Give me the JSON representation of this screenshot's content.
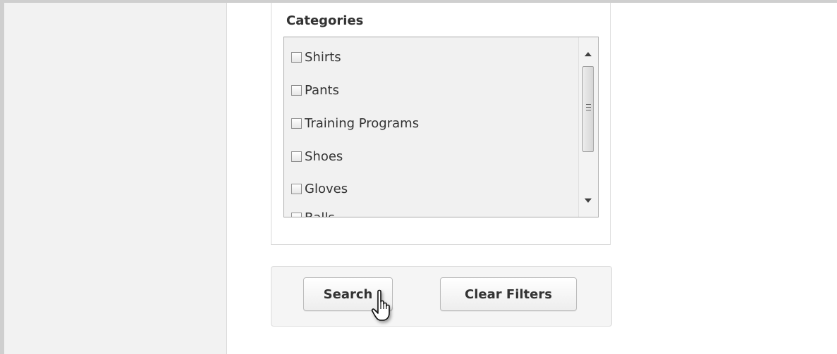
{
  "categories": {
    "title": "Categories",
    "items": [
      {
        "label": "Shirts",
        "checked": false
      },
      {
        "label": "Pants",
        "checked": false
      },
      {
        "label": "Training Programs",
        "checked": false
      },
      {
        "label": "Shoes",
        "checked": false
      },
      {
        "label": "Gloves",
        "checked": false
      },
      {
        "label": "Balls",
        "checked": false
      }
    ]
  },
  "actions": {
    "search_label": "Search",
    "clear_label": "Clear Filters"
  },
  "cursor": "hand-pointer-icon"
}
